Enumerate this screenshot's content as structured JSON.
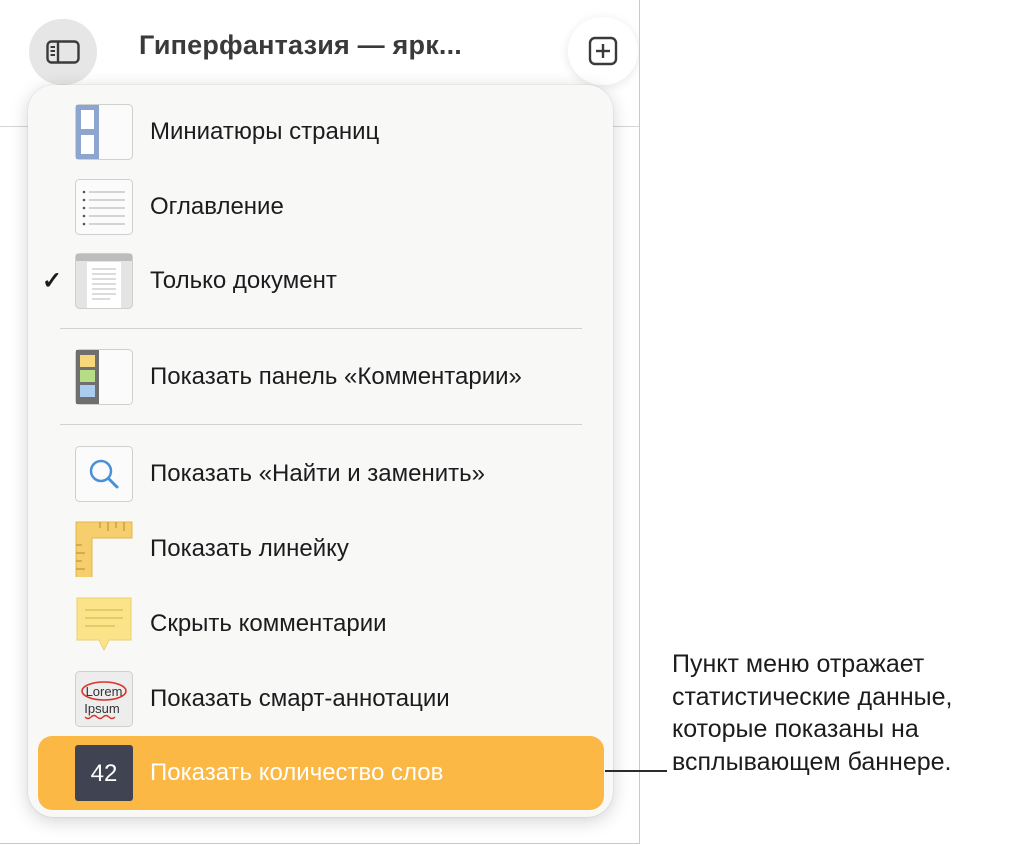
{
  "toolbar": {
    "title": "Гиперфантазия — ярк...",
    "sidebar_icon": "sidebar-icon",
    "add_icon": "add-icon"
  },
  "menu": {
    "items": [
      {
        "label": "Миниатюры страниц",
        "icon": "page-thumbnails-icon",
        "checked": false
      },
      {
        "label": "Оглавление",
        "icon": "table-of-contents-icon",
        "checked": false
      },
      {
        "label": "Только документ",
        "icon": "document-only-icon",
        "checked": true,
        "check_mark": "✓"
      },
      {
        "label": "Показать панель «Комментарии»",
        "icon": "comments-pane-icon",
        "checked": false
      },
      {
        "label": "Показать «Найти и заменить»",
        "icon": "find-replace-icon",
        "checked": false
      },
      {
        "label": "Показать линейку",
        "icon": "ruler-icon",
        "checked": false
      },
      {
        "label": "Скрыть комментарии",
        "icon": "comment-icon",
        "checked": false
      },
      {
        "label": "Показать смарт-аннотации",
        "icon": "smart-annotation-icon",
        "checked": false,
        "icon_text_1": "Lorem",
        "icon_text_2": "Ipsum"
      },
      {
        "label": "Показать количество слов",
        "icon": "word-count-icon",
        "checked": false,
        "highlighted": true,
        "icon_text": "42"
      }
    ]
  },
  "callout": {
    "lines": [
      "Пункт меню отражает",
      "статистические данные,",
      "которые показаны на",
      "всплывающем баннере."
    ]
  },
  "colors": {
    "highlight": "#fbb845",
    "menu_background": "#f8f8f7"
  }
}
